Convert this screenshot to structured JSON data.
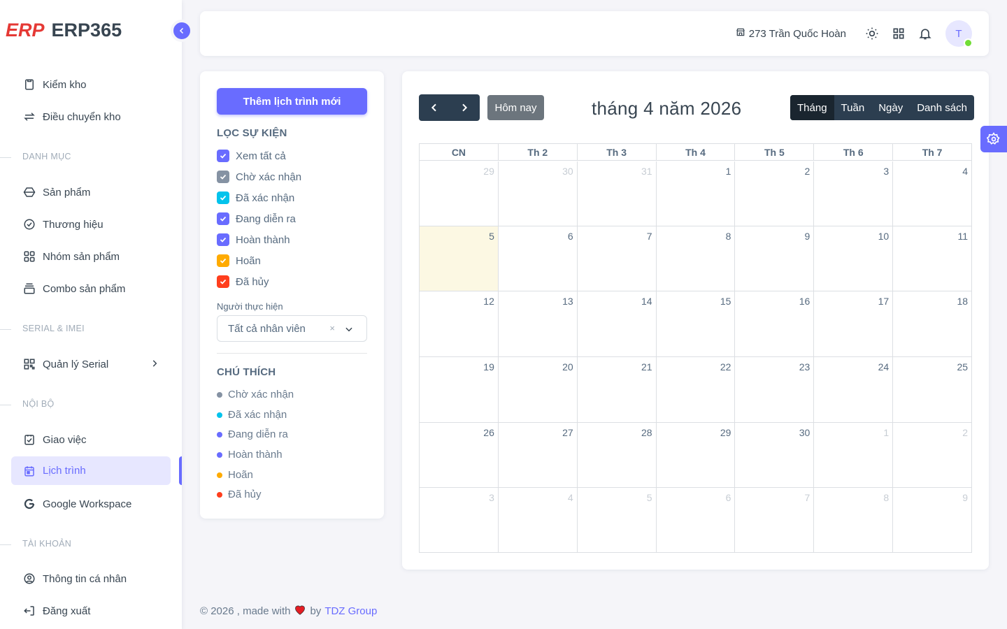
{
  "brand": {
    "logo": "ERP",
    "name": "ERP365"
  },
  "sidebar": {
    "items": [
      {
        "label": "Kiểm kho",
        "icon": "clipboard-icon"
      },
      {
        "label": "Điều chuyển kho",
        "icon": "transfer-icon"
      },
      {
        "label": "Sản phẩm",
        "icon": "box-icon"
      },
      {
        "label": "Thương hiệu",
        "icon": "badge-check-icon"
      },
      {
        "label": "Nhóm sản phẩm",
        "icon": "grid-icon"
      },
      {
        "label": "Combo sản phẩm",
        "icon": "stack-icon"
      },
      {
        "label": "Quản lý Serial",
        "icon": "qr-code-icon"
      },
      {
        "label": "Giao việc",
        "icon": "task-icon"
      },
      {
        "label": "Lịch trình",
        "icon": "calendar-icon"
      },
      {
        "label": "Google Workspace",
        "icon": "google-icon"
      },
      {
        "label": "Thông tin cá nhân",
        "icon": "user-circle-icon"
      },
      {
        "label": "Đăng xuất",
        "icon": "logout-icon"
      }
    ],
    "headers": [
      "DANH MỤC",
      "SERIAL & IMEI",
      "NỘI BỘ",
      "TÀI KHOẢN"
    ]
  },
  "navbar": {
    "branch": "273 Trần Quốc Hoàn",
    "avatar": "T"
  },
  "filter": {
    "add_button": "Thêm lịch trình mới",
    "filter_title": "LỌC SỰ KIỆN",
    "checks": [
      {
        "label": "Xem tất cả",
        "color": "#696cff"
      },
      {
        "label": "Chờ xác nhận",
        "color": "#8592a3"
      },
      {
        "label": "Đã xác nhận",
        "color": "#03c3ec"
      },
      {
        "label": "Đang diễn ra",
        "color": "#696cff"
      },
      {
        "label": "Hoàn thành",
        "color": "#696cff"
      },
      {
        "label": "Hoãn",
        "color": "#ffab00"
      },
      {
        "label": "Đã hủy",
        "color": "#ff3e1d"
      }
    ],
    "assignee_label": "Người thực hiện",
    "assignee_value": "Tất cả nhân viên",
    "clear": "×",
    "legend_title": "CHÚ THÍCH",
    "legend": [
      {
        "label": "Chờ xác nhận",
        "color": "#8592a3"
      },
      {
        "label": "Đã xác nhận",
        "color": "#03c3ec"
      },
      {
        "label": "Đang diễn ra",
        "color": "#696cff"
      },
      {
        "label": "Hoàn thành",
        "color": "#696cff"
      },
      {
        "label": "Hoãn",
        "color": "#ffab00"
      },
      {
        "label": "Đã hủy",
        "color": "#ff3e1d"
      }
    ]
  },
  "calendar": {
    "today_button": "Hôm nay",
    "title": "tháng 4 năm 2026",
    "views": [
      "Tháng",
      "Tuần",
      "Ngày",
      "Danh sách"
    ],
    "active_view": "Tháng",
    "weekdays": [
      "CN",
      "Th 2",
      "Th 3",
      "Th 4",
      "Th 5",
      "Th 6",
      "Th 7"
    ],
    "weeks": [
      [
        {
          "d": "29",
          "o": true
        },
        {
          "d": "30",
          "o": true
        },
        {
          "d": "31",
          "o": true
        },
        {
          "d": "1"
        },
        {
          "d": "2"
        },
        {
          "d": "3"
        },
        {
          "d": "4"
        }
      ],
      [
        {
          "d": "5",
          "t": true
        },
        {
          "d": "6"
        },
        {
          "d": "7"
        },
        {
          "d": "8"
        },
        {
          "d": "9"
        },
        {
          "d": "10"
        },
        {
          "d": "11"
        }
      ],
      [
        {
          "d": "12"
        },
        {
          "d": "13"
        },
        {
          "d": "14"
        },
        {
          "d": "15"
        },
        {
          "d": "16"
        },
        {
          "d": "17"
        },
        {
          "d": "18"
        }
      ],
      [
        {
          "d": "19"
        },
        {
          "d": "20"
        },
        {
          "d": "21"
        },
        {
          "d": "22"
        },
        {
          "d": "23"
        },
        {
          "d": "24"
        },
        {
          "d": "25"
        }
      ],
      [
        {
          "d": "26"
        },
        {
          "d": "27"
        },
        {
          "d": "28"
        },
        {
          "d": "29"
        },
        {
          "d": "30"
        },
        {
          "d": "1",
          "o": true
        },
        {
          "d": "2",
          "o": true
        }
      ],
      [
        {
          "d": "3",
          "o": true
        },
        {
          "d": "4",
          "o": true
        },
        {
          "d": "5",
          "o": true
        },
        {
          "d": "6",
          "o": true
        },
        {
          "d": "7",
          "o": true
        },
        {
          "d": "8",
          "o": true
        },
        {
          "d": "9",
          "o": true
        }
      ]
    ]
  },
  "footer": {
    "prefix": "© 2026 , made with",
    "by": "by",
    "company": "TDZ Group"
  }
}
